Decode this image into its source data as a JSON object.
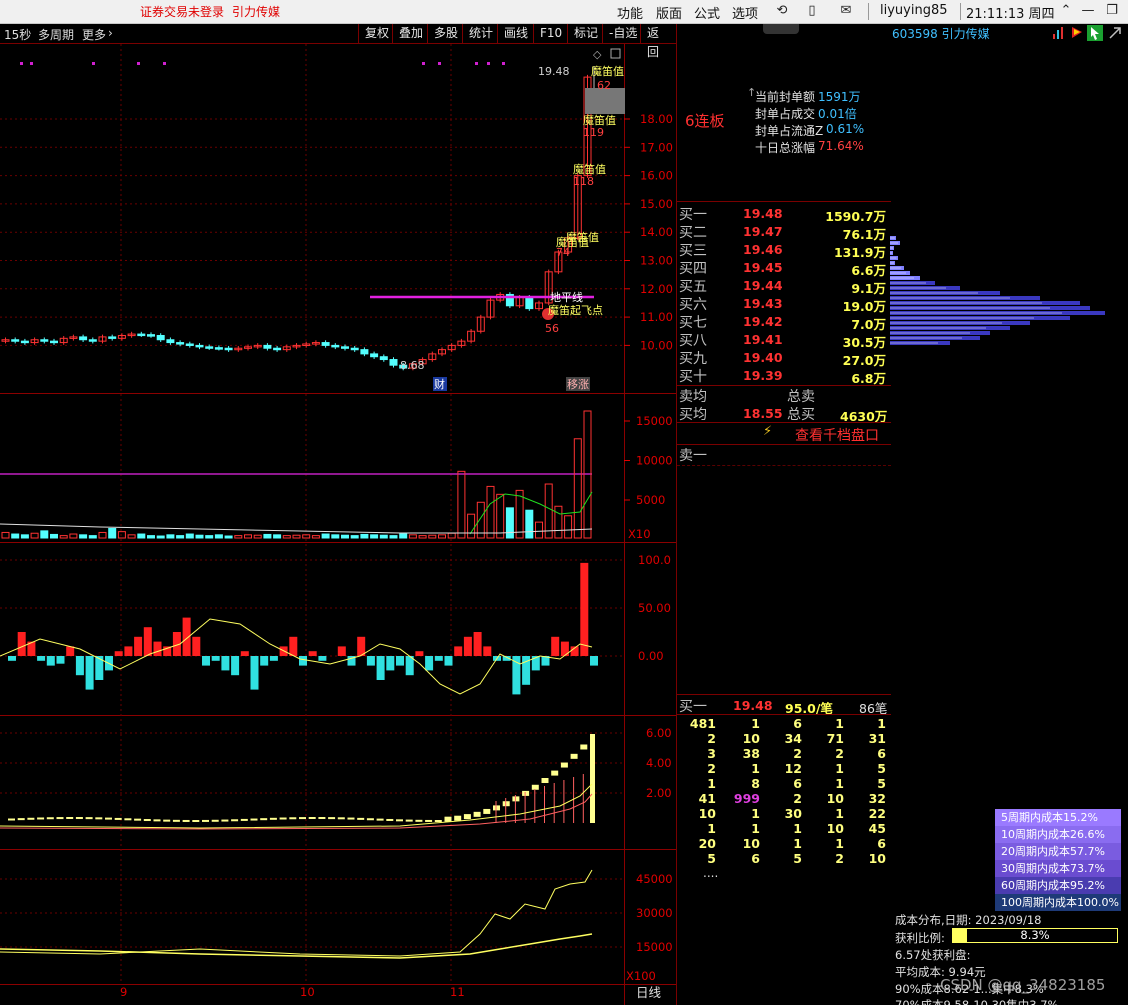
{
  "topbar": {
    "warning": "证券交易未登录",
    "stock_tag": "引力传媒",
    "menus": [
      "功能",
      "版面",
      "公式",
      "选项"
    ],
    "user": "liyuying85",
    "clock": "21:11:13 周四"
  },
  "toolbar": {
    "period": "15秒",
    "multi_period": "多周期",
    "more": "更多",
    "buttons": [
      "复权",
      "叠加",
      "多股",
      "统计",
      "画线",
      "F10",
      "标记",
      "-自选",
      "返回"
    ]
  },
  "chart": {
    "price_axis": [
      "18.00",
      "17.00",
      "16.00",
      "15.00",
      "14.00",
      "13.00",
      "12.00",
      "11.00",
      "10.00"
    ],
    "vol_axis": [
      "15000",
      "10000",
      "5000"
    ],
    "vol_unit": "X10",
    "ind1_axis": [
      "100.0",
      "50.00",
      "0.00"
    ],
    "ind2_axis": [
      "6.00",
      "4.00",
      "2.00"
    ],
    "ind3_axis": [
      "45000",
      "30000",
      "15000"
    ],
    "ind3_unit": "X100",
    "annotations": {
      "high_price": "19.48",
      "low_price": "8.68",
      "moutai": "魔笛值",
      "num62": "62",
      "num119": "119",
      "num118": "118",
      "num74": "74",
      "num56": "56",
      "horizon_line": "地平线",
      "takeoff": "魔笛起飞点",
      "cai": "财",
      "jizhang": "移涨"
    },
    "date_axis": [
      "9",
      "10",
      "11"
    ],
    "period_bottom": "日线"
  },
  "rightpanel": {
    "stock": "603598 引力传媒",
    "board_streak": "6连板",
    "seal_stats": [
      {
        "label": "当前封单额",
        "value": "1591万"
      },
      {
        "label": "封单占成交",
        "value": "0.01倍"
      },
      {
        "label": "封单占流通Z",
        "value": "0.61%"
      },
      {
        "label": "十日总涨幅",
        "value": "71.64%"
      }
    ],
    "bids": [
      {
        "label": "买一",
        "price": "19.48",
        "vol": "1590.7万"
      },
      {
        "label": "买二",
        "price": "19.47",
        "vol": "76.1万"
      },
      {
        "label": "买三",
        "price": "19.46",
        "vol": "131.9万"
      },
      {
        "label": "买四",
        "price": "19.45",
        "vol": "6.6万"
      },
      {
        "label": "买五",
        "price": "19.44",
        "vol": "9.1万"
      },
      {
        "label": "买六",
        "price": "19.43",
        "vol": "19.0万"
      },
      {
        "label": "买七",
        "price": "19.42",
        "vol": "7.0万"
      },
      {
        "label": "买八",
        "price": "19.41",
        "vol": "30.5万"
      },
      {
        "label": "买九",
        "price": "19.40",
        "vol": "27.0万"
      },
      {
        "label": "买十",
        "price": "19.39",
        "vol": "6.8万"
      }
    ],
    "sell_avg": "卖均",
    "total_sell": "总卖",
    "buy_avg": "买均",
    "buy_avg_price": "18.55",
    "total_buy": "总买",
    "total_buy_val": "4630万",
    "qiandang": "查看千档盘口",
    "sell1": "卖一",
    "queue_label": "买一",
    "queue_price": "19.48",
    "queue_avg": "95.0/笔",
    "queue_count": "86笔",
    "queue_rows": [
      [
        "481",
        "1",
        "6",
        "1",
        "1"
      ],
      [
        "2",
        "10",
        "34",
        "71",
        "31"
      ],
      [
        "3",
        "38",
        "2",
        "2",
        "6"
      ],
      [
        "2",
        "1",
        "12",
        "1",
        "5"
      ],
      [
        "1",
        "8",
        "6",
        "1",
        "5"
      ],
      [
        "41",
        "999",
        "2",
        "10",
        "32"
      ],
      [
        "10",
        "1",
        "30",
        "1",
        "22"
      ],
      [
        "1",
        "1",
        "1",
        "10",
        "45"
      ],
      [
        "20",
        "10",
        "1",
        "1",
        "6"
      ],
      [
        "5",
        "6",
        "5",
        "2",
        "10"
      ]
    ],
    "ellipsis": "...."
  },
  "farright": {
    "cost_rows": [
      {
        "text": "5周期内成本15.2%",
        "color": "#9a7aff"
      },
      {
        "text": "10周期内成本26.6%",
        "color": "#8a6cf0"
      },
      {
        "text": "20周期内成本57.7%",
        "color": "#7a5ce0"
      },
      {
        "text": "30周期内成本73.7%",
        "color": "#6a4cd0"
      },
      {
        "text": "60周期内成本95.2%",
        "color": "#4a3cb0"
      },
      {
        "text": "100周期内成本100.0%",
        "color": "#1e3a78"
      }
    ],
    "cost_date": "成本分布,日期: 2023/09/18",
    "profit_label": "获利比例:",
    "profit_value": "8.3%",
    "profit_ratio": 0.083,
    "line3": "6.57处获利盘:",
    "avg_cost": "平均成本: 9.94元",
    "line5": "90%成本8.62-1...集中8.3%",
    "line6": "70%成本9.58-10.30集中3.7%",
    "watermark": "CSDN @qq_34823185"
  }
}
